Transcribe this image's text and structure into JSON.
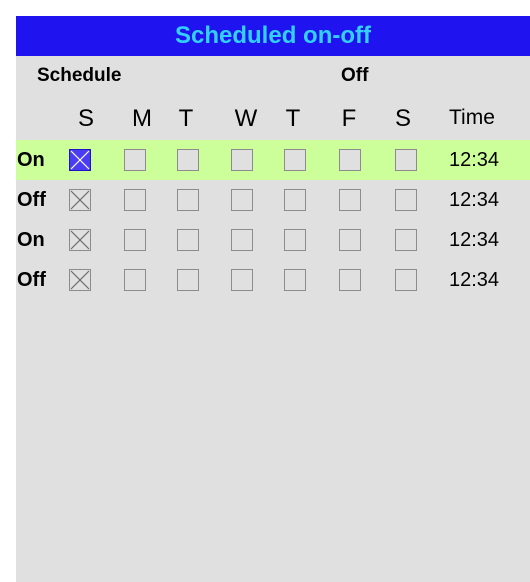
{
  "title": "Scheduled on-off",
  "header": {
    "schedule_label": "Schedule",
    "mode_label": "Off"
  },
  "days": [
    "S",
    "M",
    "T",
    "W",
    "T",
    "F",
    "S"
  ],
  "time_header": "Time",
  "rows": [
    {
      "label": "On",
      "time": "12:34",
      "checked": [
        true,
        false,
        false,
        false,
        false,
        false,
        false
      ],
      "selected": true
    },
    {
      "label": "Off",
      "time": "12:34",
      "checked": [
        true,
        false,
        false,
        false,
        false,
        false,
        false
      ],
      "selected": false
    },
    {
      "label": "On",
      "time": "12:34",
      "checked": [
        true,
        false,
        false,
        false,
        false,
        false,
        false
      ],
      "selected": false
    },
    {
      "label": "Off",
      "time": "12:34",
      "checked": [
        true,
        false,
        false,
        false,
        false,
        false,
        false
      ],
      "selected": false
    }
  ],
  "colors": {
    "title_bg": "#1f14f0",
    "title_text": "#33d0ff",
    "panel_bg": "#e0e0e0",
    "selected_row": "#ccff99",
    "focus_checkbox": "#4a3cf2"
  }
}
